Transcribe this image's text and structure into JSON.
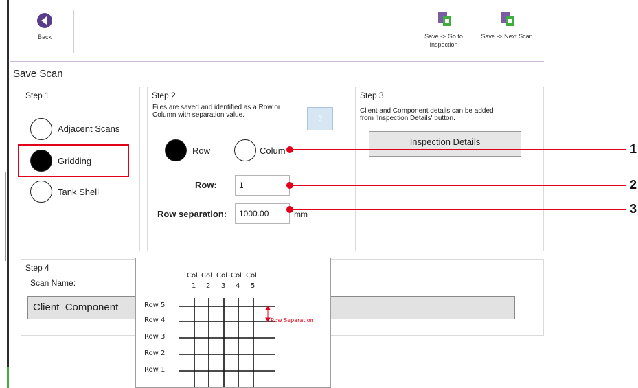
{
  "toolbar": {
    "back_label": "Back",
    "save_goto_label_1": "Save -> Go to",
    "save_goto_label_2": "Inspection",
    "save_next_label": "Save -> Next Scan"
  },
  "page": {
    "title": "Save Scan"
  },
  "step1": {
    "title": "Step 1",
    "options": [
      "Adjacent Scans",
      "Gridding",
      "Tank Shell"
    ],
    "selected": "Gridding"
  },
  "step2": {
    "title": "Step 2",
    "description_1": "Files are saved and identified as a Row or",
    "description_2": "Column with separation value.",
    "help_label": "?",
    "row_option": "Row",
    "column_option": "Colum",
    "selected": "Row",
    "row_label": "Row:",
    "row_value": "1",
    "separation_label": "Row separation:",
    "separation_value": "1000.00",
    "separation_unit": "mm"
  },
  "step3": {
    "title": "Step 3",
    "description_1": "Client and Component details can be added",
    "description_2": "from 'Inspection Details' button.",
    "button_label": "Inspection Details"
  },
  "step4": {
    "title": "Step 4",
    "scan_name_label": "Scan Name:",
    "scan_name_value": "Client_Component"
  },
  "diagram": {
    "col_header": [
      "Col",
      "Col",
      "Col",
      "Col",
      "Col"
    ],
    "col_numbers": [
      "1",
      "2",
      "3",
      "4",
      "5"
    ],
    "rows": [
      "Row 5",
      "Row 4",
      "Row 3",
      "Row 2",
      "Row 1"
    ],
    "separation_label": "Row Separation"
  },
  "callouts": [
    "1",
    "2",
    "3"
  ],
  "colors": {
    "accent_red": "#e2001a",
    "toolbar_rule": "#c9b8d6",
    "icon_green": "#3fae3f",
    "icon_purple": "#7b5aa6"
  }
}
